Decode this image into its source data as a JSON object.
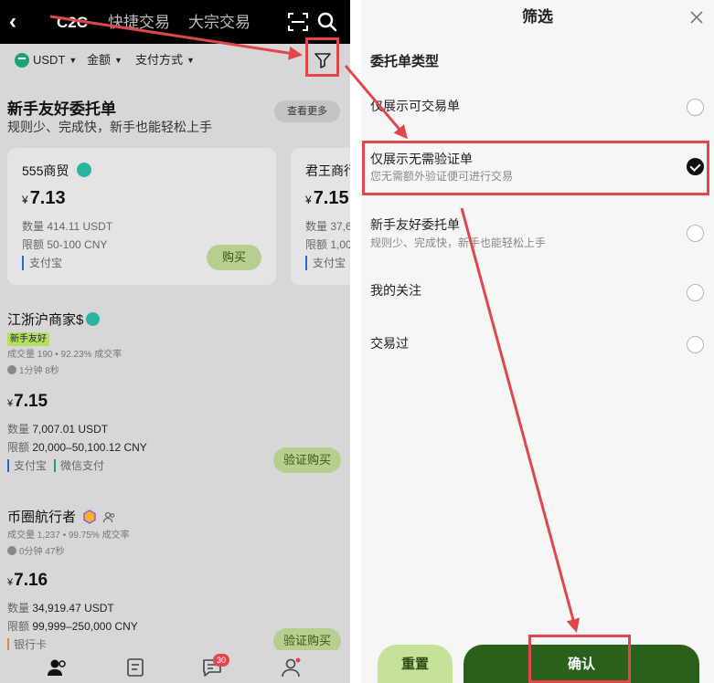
{
  "left": {
    "topbar": {
      "back_icon": "chevron-left-icon",
      "tabs": [
        "C2C",
        "快捷交易",
        "大宗交易"
      ],
      "scan_icon": "scan-icon",
      "search_icon": "search-icon"
    },
    "filterbar": {
      "coin": "USDT",
      "amount": "金额",
      "payment": "支付方式",
      "filter_icon": "funnel-icon"
    },
    "friendly": {
      "title": "新手友好委托单",
      "subtitle": "规则少、完成快，新手也能轻松上手",
      "more": "查看更多",
      "cards": [
        {
          "name": "555商贸",
          "currency": "¥",
          "price": "7.13",
          "qty": "数量 414.11 USDT",
          "limit": "限额 50-100 CNY",
          "pay": "支付宝",
          "buy": "购买"
        },
        {
          "name": "君王商行",
          "currency": "¥",
          "price": "7.15",
          "qty": "数量 37,6",
          "limit": "限额 1,00",
          "pay": "支付宝"
        }
      ]
    },
    "merchants": [
      {
        "name": "江浙沪商家$",
        "tag": "新手友好",
        "volume": "成交量 190",
        "rate": "92.23% 成交率",
        "time": "1分钟 8秒",
        "currency": "¥",
        "price": "7.15",
        "qty_label": "数量",
        "qty": "7,007.01 USDT",
        "limit_label": "限额",
        "limit": "20,000–50,100.12 CNY",
        "pays": [
          "支付宝",
          "微信支付"
        ],
        "button": "验证购买"
      },
      {
        "name": "币圈航行者",
        "volume": "成交量 1,237",
        "rate": "99.75% 成交率",
        "time": "0分钟 47秒",
        "currency": "¥",
        "price": "7.16",
        "qty_label": "数量",
        "qty": "34,919.47 USDT",
        "limit_label": "限额",
        "limit": "99,999–250,000 CNY",
        "pays": [
          "银行卡"
        ],
        "button": "验证购买"
      }
    ],
    "bottomnav": {
      "badge": "30"
    }
  },
  "sheet": {
    "title": "筛选",
    "section": "委托单类型",
    "options": [
      {
        "label": "仅展示可交易单",
        "desc": "",
        "selected": false
      },
      {
        "label": "仅展示无需验证单",
        "desc": "您无需额外验证便可进行交易",
        "selected": true
      },
      {
        "label": "新手友好委托单",
        "desc": "规则少、完成快，新手也能轻松上手",
        "selected": false
      },
      {
        "label": "我的关注",
        "desc": "",
        "selected": false
      },
      {
        "label": "交易过",
        "desc": "",
        "selected": false
      }
    ],
    "reset": "重置",
    "confirm": "确认"
  },
  "colors": {
    "annotation_red": "#e0474c",
    "confirm_green": "#2a5f1c",
    "reset_green": "#c6e19a",
    "buy_green": "#b7cf8e"
  }
}
